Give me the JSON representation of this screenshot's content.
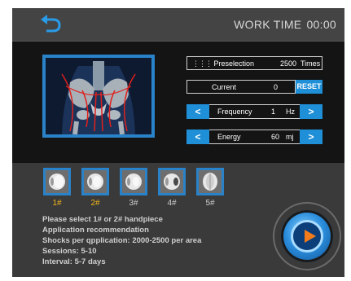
{
  "header": {
    "worktime_label": "WORK TIME",
    "worktime_value": "00:00",
    "back_icon": "back-arrow-icon"
  },
  "params": {
    "preselection": {
      "label": "Preselection",
      "value": "2500",
      "unit": "Times",
      "icon": "dots-grid-icon"
    },
    "current": {
      "label": "Current",
      "value": "0"
    },
    "reset_label": "RESET",
    "frequency": {
      "label": "Frequency",
      "value": "1",
      "unit": "Hz"
    },
    "energy": {
      "label": "Energy",
      "value": "60",
      "unit": "mj"
    },
    "arrow_left": "<",
    "arrow_right": ">"
  },
  "handpieces": [
    {
      "label": "1#",
      "active": true
    },
    {
      "label": "2#",
      "active": true
    },
    {
      "label": "3#",
      "active": false
    },
    {
      "label": "4#",
      "active": false
    },
    {
      "label": "5#",
      "active": false
    }
  ],
  "info": {
    "line1": "Please select 1# or 2# handpiece",
    "line2": "Application recommendation",
    "line3": "Shocks per qpplication:  2000-2500 per area",
    "line4": "Sessions:  5-10",
    "line5": "Interval:  5-7 days"
  },
  "colors": {
    "accent": "#1f8fd8",
    "active_label": "#f2b51a",
    "play_icon": "#f37b1b"
  }
}
